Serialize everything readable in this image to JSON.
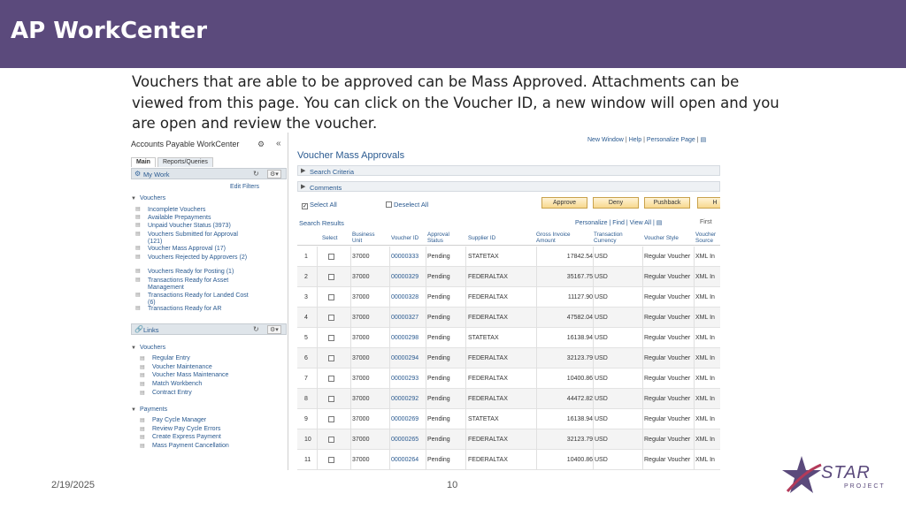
{
  "slide": {
    "title": "AP WorkCenter",
    "intro": "Vouchers that are able to be approved can be Mass Approved.  Attachments can be viewed from this page.  You can click on the Voucher ID, a new window will open and you are open and review the voucher.",
    "date": "2/19/2025",
    "page_number": "10",
    "logo": {
      "main": "STAR",
      "sub": "PROJECT",
      "colors": {
        "star": "#5b4a7c",
        "accent": "#b33a5a"
      }
    }
  },
  "workcenter": {
    "title": "Accounts Payable WorkCenter",
    "tabs": [
      "Main",
      "Reports/Queries"
    ],
    "my_work": {
      "label": "My Work",
      "edit_filters": "Edit Filters",
      "group": "Vouchers",
      "items": [
        {
          "label": "Incomplete Vouchers"
        },
        {
          "label": "Available Prepayments"
        },
        {
          "label": "Unpaid Voucher Status (3973)"
        },
        {
          "label": "Vouchers Submitted for Approval (121)"
        },
        {
          "label": "Voucher Mass Approval (17)"
        },
        {
          "label": "Vouchers Rejected by Approvers (2)"
        },
        {
          "label": "Vouchers Ready for Posting (1)"
        },
        {
          "label": "Transactions Ready for Asset Management"
        },
        {
          "label": "Transactions Ready for Landed Cost (6)"
        },
        {
          "label": "Transactions Ready for AR"
        }
      ]
    },
    "links": {
      "label": "Links",
      "groups": [
        {
          "name": "Vouchers",
          "items": [
            "Regular Entry",
            "Voucher Maintenance",
            "Voucher Mass Maintenance",
            "Match Workbench",
            "Contract Entry"
          ]
        },
        {
          "name": "Payments",
          "items": [
            "Pay Cycle Manager",
            "Review Pay Cycle Errors",
            "Create Express Payment",
            "Mass Payment Cancellation"
          ]
        }
      ]
    }
  },
  "vma": {
    "toplinks": [
      "New Window",
      "Help",
      "Personalize Page"
    ],
    "title": "Voucher Mass Approvals",
    "search_criteria": "Search Criteria",
    "comments": "Comments",
    "select_all": "Select All",
    "deselect_all": "Deselect All",
    "buttons": {
      "approve": "Approve",
      "deny": "Deny",
      "pushback": "Pushback",
      "more": "H"
    },
    "results": {
      "label": "Search Results",
      "links": "Personalize | Find | View All |",
      "first": "First",
      "columns": [
        "Select",
        "Business Unit",
        "Voucher ID",
        "Approval Status",
        "Supplier ID",
        "Gross Invoice Amount",
        "Transaction Currency",
        "Voucher Style",
        "Voucher Source"
      ],
      "rows": [
        {
          "n": "1",
          "bu": "37000",
          "id": "00000333",
          "status": "Pending",
          "supplier": "STATETAX",
          "amount": "17842.54",
          "cur": "USD",
          "style": "Regular Voucher",
          "source": "XML In"
        },
        {
          "n": "2",
          "bu": "37000",
          "id": "00000329",
          "status": "Pending",
          "supplier": "FEDERALTAX",
          "amount": "35167.75",
          "cur": "USD",
          "style": "Regular Voucher",
          "source": "XML In"
        },
        {
          "n": "3",
          "bu": "37000",
          "id": "00000328",
          "status": "Pending",
          "supplier": "FEDERALTAX",
          "amount": "11127.90",
          "cur": "USD",
          "style": "Regular Voucher",
          "source": "XML In"
        },
        {
          "n": "4",
          "bu": "37000",
          "id": "00000327",
          "status": "Pending",
          "supplier": "FEDERALTAX",
          "amount": "47582.04",
          "cur": "USD",
          "style": "Regular Voucher",
          "source": "XML In"
        },
        {
          "n": "5",
          "bu": "37000",
          "id": "00000298",
          "status": "Pending",
          "supplier": "STATETAX",
          "amount": "16138.94",
          "cur": "USD",
          "style": "Regular Voucher",
          "source": "XML In"
        },
        {
          "n": "6",
          "bu": "37000",
          "id": "00000294",
          "status": "Pending",
          "supplier": "FEDERALTAX",
          "amount": "32123.79",
          "cur": "USD",
          "style": "Regular Voucher",
          "source": "XML In"
        },
        {
          "n": "7",
          "bu": "37000",
          "id": "00000293",
          "status": "Pending",
          "supplier": "FEDERALTAX",
          "amount": "10400.86",
          "cur": "USD",
          "style": "Regular Voucher",
          "source": "XML In"
        },
        {
          "n": "8",
          "bu": "37000",
          "id": "00000292",
          "status": "Pending",
          "supplier": "FEDERALTAX",
          "amount": "44472.82",
          "cur": "USD",
          "style": "Regular Voucher",
          "source": "XML In"
        },
        {
          "n": "9",
          "bu": "37000",
          "id": "00000269",
          "status": "Pending",
          "supplier": "STATETAX",
          "amount": "16138.94",
          "cur": "USD",
          "style": "Regular Voucher",
          "source": "XML In"
        },
        {
          "n": "10",
          "bu": "37000",
          "id": "00000265",
          "status": "Pending",
          "supplier": "FEDERALTAX",
          "amount": "32123.79",
          "cur": "USD",
          "style": "Regular Voucher",
          "source": "XML In"
        },
        {
          "n": "11",
          "bu": "37000",
          "id": "00000264",
          "status": "Pending",
          "supplier": "FEDERALTAX",
          "amount": "10400.86",
          "cur": "USD",
          "style": "Regular Voucher",
          "source": "XML In"
        }
      ]
    }
  }
}
